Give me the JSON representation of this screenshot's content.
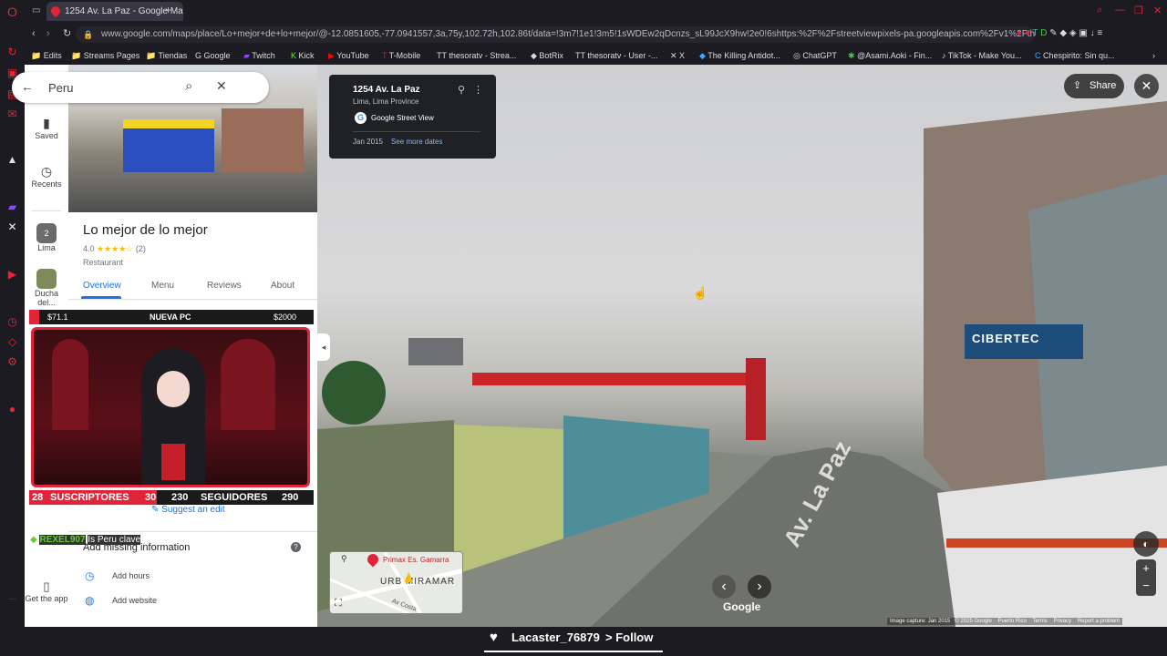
{
  "browser": {
    "tab_title": "1254 Av. La Paz - Google Maps",
    "url": "www.google.com/maps/place/Lo+mejor+de+lo+mejor/@-12.0851605,-77.0941557,3a,75y,102.72h,102.86t/data=!3m7!1e1!3m5!1sWDEw2qDcnzs_sL99JcX9hw!2e0!6shttps:%2F%2Fstreetviewpixels-pa.googleapis.com%2Fv1%2Fthumbnail%3",
    "bookmarks": [
      "Edits",
      "Streams Pages",
      "Tiendas",
      "Google",
      "Twitch",
      "Kick",
      "YouTube",
      "T-Mobile",
      "thesoratv - Strea...",
      "BotRix",
      "thesoratv - User -...",
      "X",
      "The Killing Antidot...",
      "ChatGPT",
      "@Asami.Aoki - Fin...",
      "TikTok - Make You...",
      "Chespirito: Sin qu..."
    ]
  },
  "maps": {
    "search_value": "Peru",
    "rail": {
      "saved": "Saved",
      "recents": "Recents",
      "lima": "Lima",
      "ducha": "Ducha del...",
      "get_app": "Get the app",
      "lima_badge": "2"
    },
    "place": {
      "name": "Lo mejor de lo mejor",
      "rating": "4.0",
      "stars": "★★★★☆",
      "review_count": "(2)",
      "category": "Restaurant"
    },
    "tabs": [
      "Overview",
      "Menu",
      "Reviews",
      "About"
    ],
    "suggest_edit": "Suggest an edit",
    "missing_info": "Add missing information",
    "add_hours": "Add hours",
    "add_website": "Add website"
  },
  "streetview": {
    "address": "1254 Av. La Paz",
    "locality": "Lima, Lima Province",
    "source": "Google Street View",
    "date": "Jan 2015",
    "more_dates": "See more dates",
    "share": "Share",
    "street_label": "Av. La Paz",
    "sign_text": "CIBERTEC",
    "google_logo": "Google",
    "minimap_place": "Primax Es. Gamarra",
    "minimap_area": "URB MIRAMAR",
    "minimap_street": "Av Costa",
    "footer": [
      "Image capture: Jan 2015",
      "© 2025 Google",
      "Puerto Rico",
      "Terms",
      "Privacy",
      "Report a problem"
    ]
  },
  "stream_overlay": {
    "goal_left": "$71.1",
    "goal_title": "NUEVA PC",
    "goal_right": "$2000",
    "subs_current": "28",
    "subs_label": "SUSCRIPTORES",
    "subs_goal": "30",
    "follows_current": "230",
    "follows_label": "SEGUIDORES",
    "follows_goal": "290",
    "chat_user": "REXEL907",
    "chat_msg": "Is Peru clave"
  },
  "follow_alert": {
    "user": "Lacaster_76879",
    "action": "> Follow"
  },
  "colors": {
    "accent_red": "#e2243b",
    "maps_blue": "#1a73e8",
    "panel_dark": "#202124"
  }
}
